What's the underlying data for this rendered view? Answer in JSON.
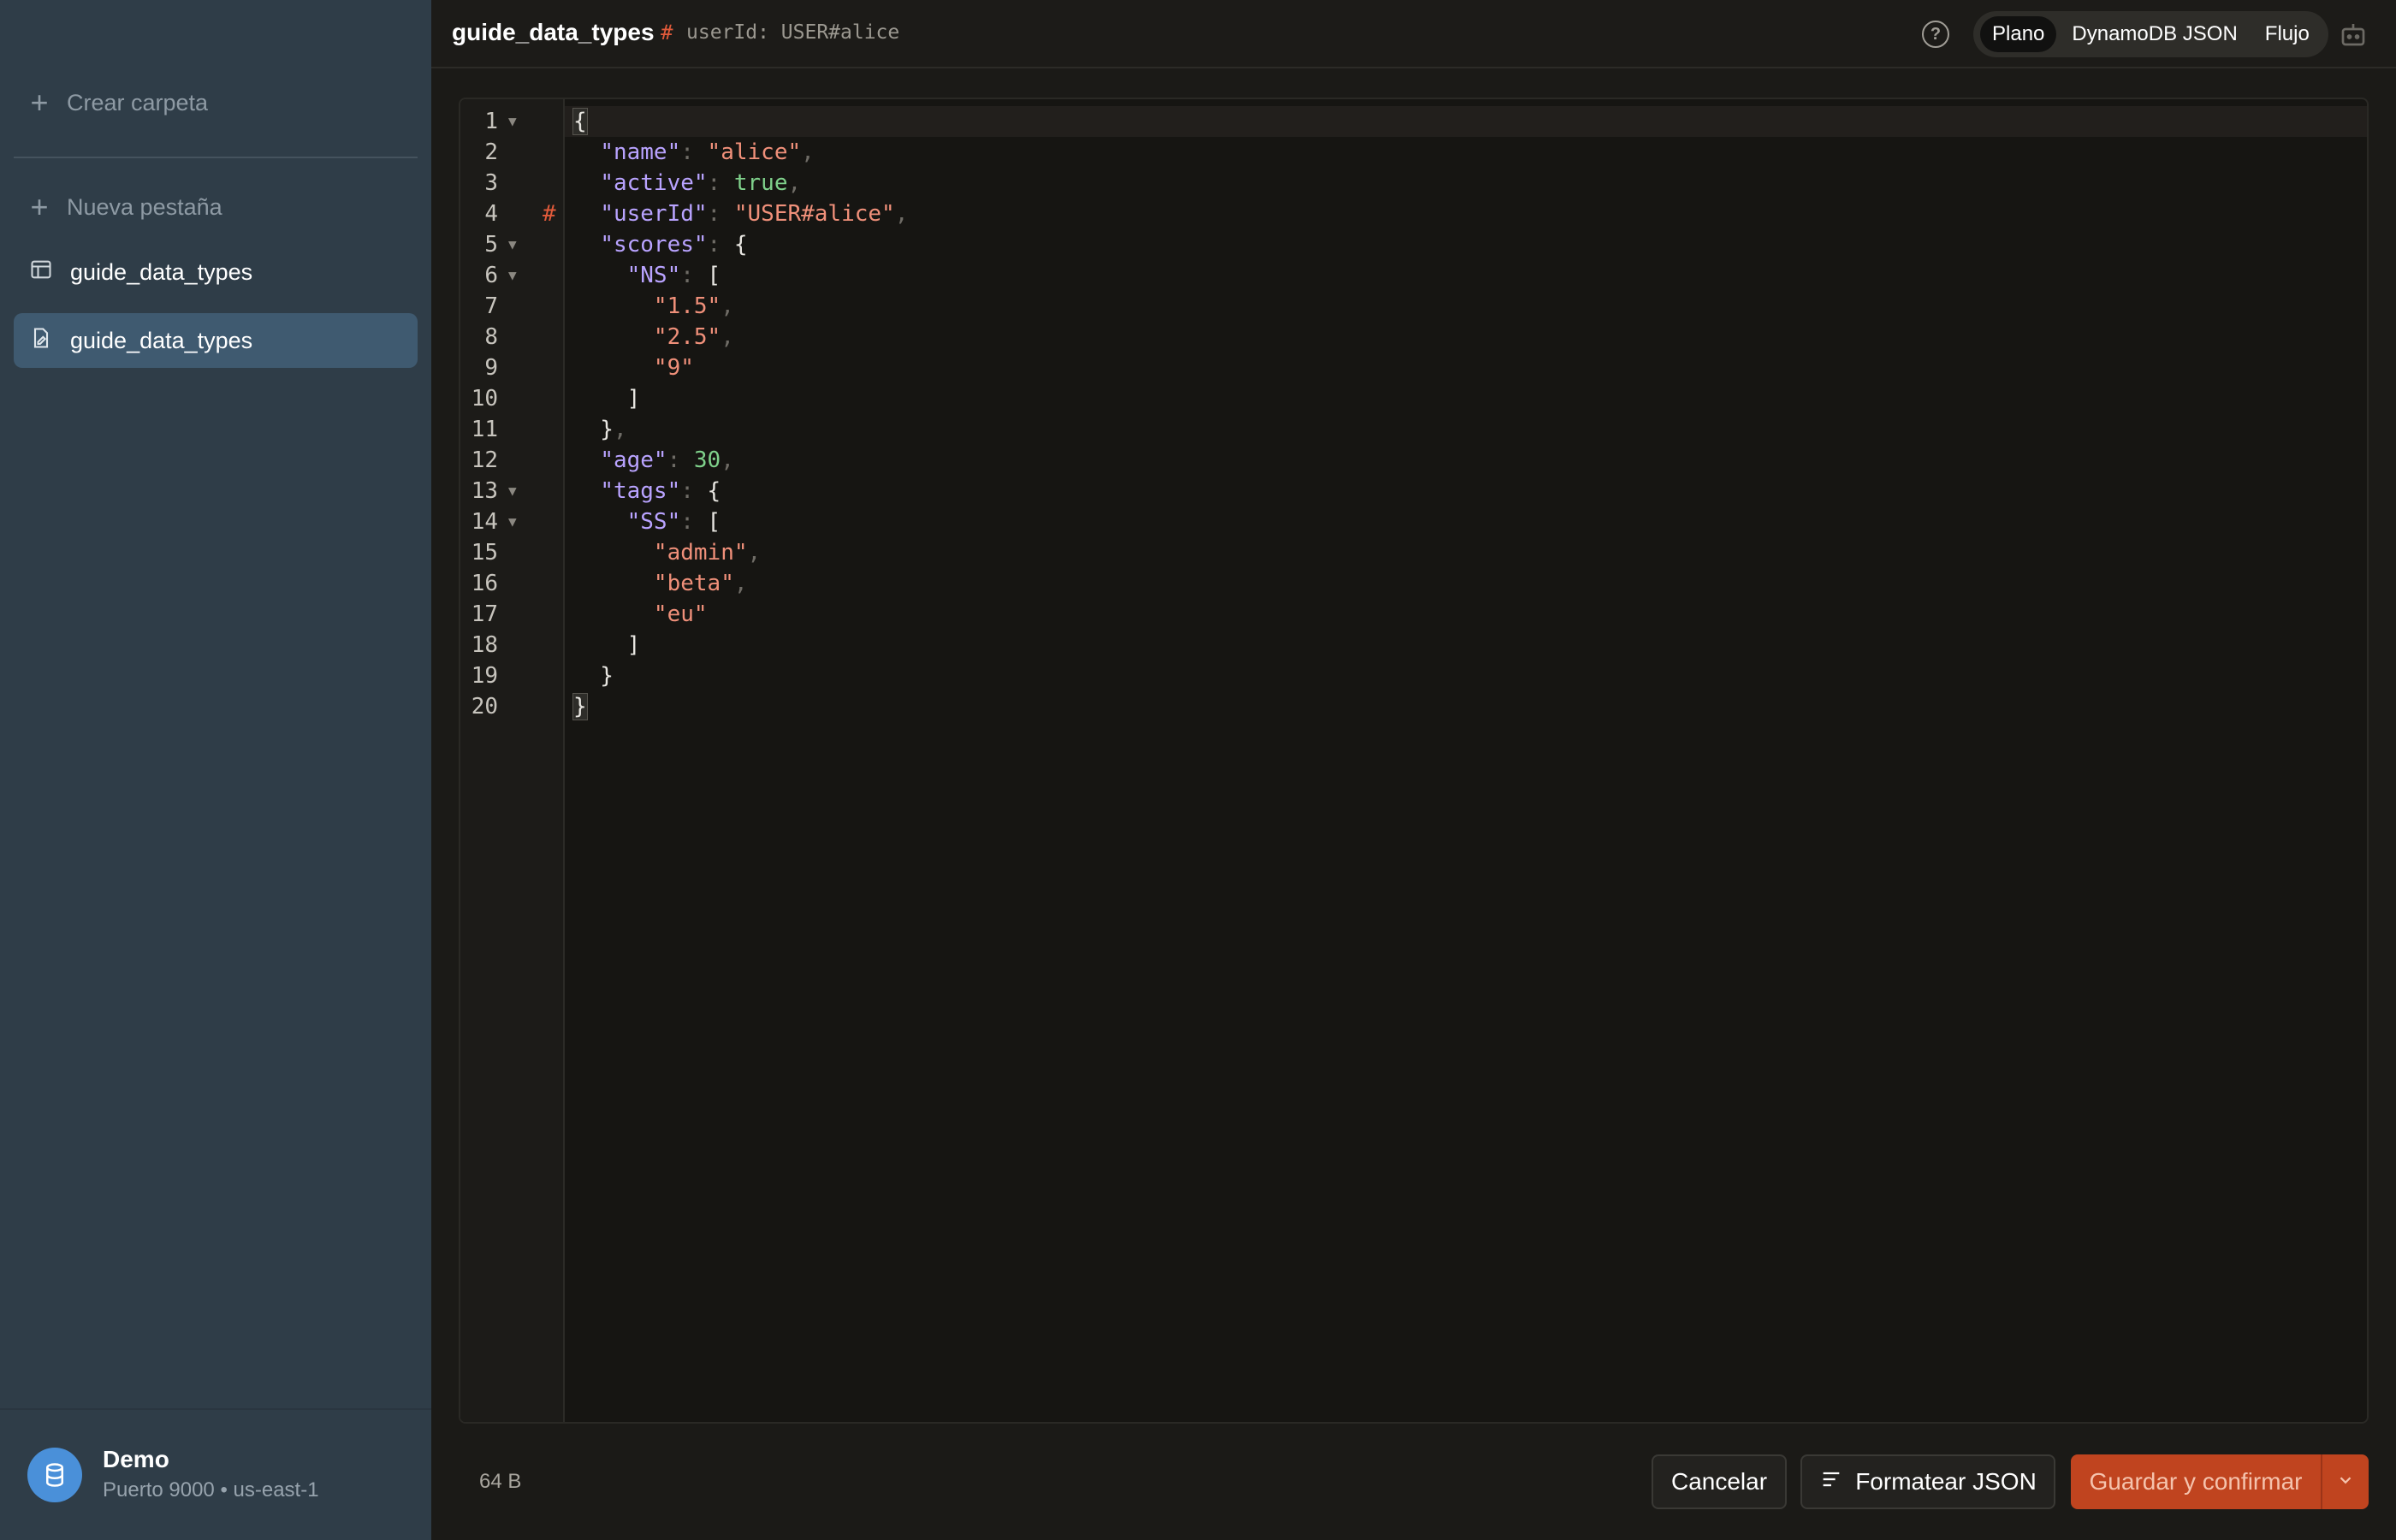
{
  "sidebar": {
    "create_folder": "Crear carpeta",
    "new_tab": "Nueva pestaña",
    "items": [
      {
        "label": "guide_data_types",
        "icon": "table-icon"
      },
      {
        "label": "guide_data_types",
        "icon": "document-edit-icon"
      }
    ],
    "connection": {
      "name": "Demo",
      "detail": "Puerto 9000 • us-east-1"
    }
  },
  "header": {
    "title": "guide_data_types",
    "key_marker": "#",
    "key_label": "userId: USER#alice",
    "modes": [
      "Plano",
      "DynamoDB JSON",
      "Flujo"
    ],
    "active_mode": "Plano"
  },
  "editor": {
    "line_numbers": [
      "1",
      "2",
      "3",
      "4",
      "5",
      "6",
      "7",
      "8",
      "9",
      "10",
      "11",
      "12",
      "13",
      "14",
      "15",
      "16",
      "17",
      "18",
      "19",
      "20"
    ],
    "key_marker_line": "4"
  },
  "footer": {
    "size": "64 B",
    "cancel": "Cancelar",
    "format": "Formatear JSON",
    "save": "Guardar y confirmar"
  },
  "colors": {
    "accent": "#c0441f",
    "key": "#b9a3ff",
    "string": "#f0907a",
    "boolean": "#7fd18b",
    "marker": "#e05a3a"
  }
}
